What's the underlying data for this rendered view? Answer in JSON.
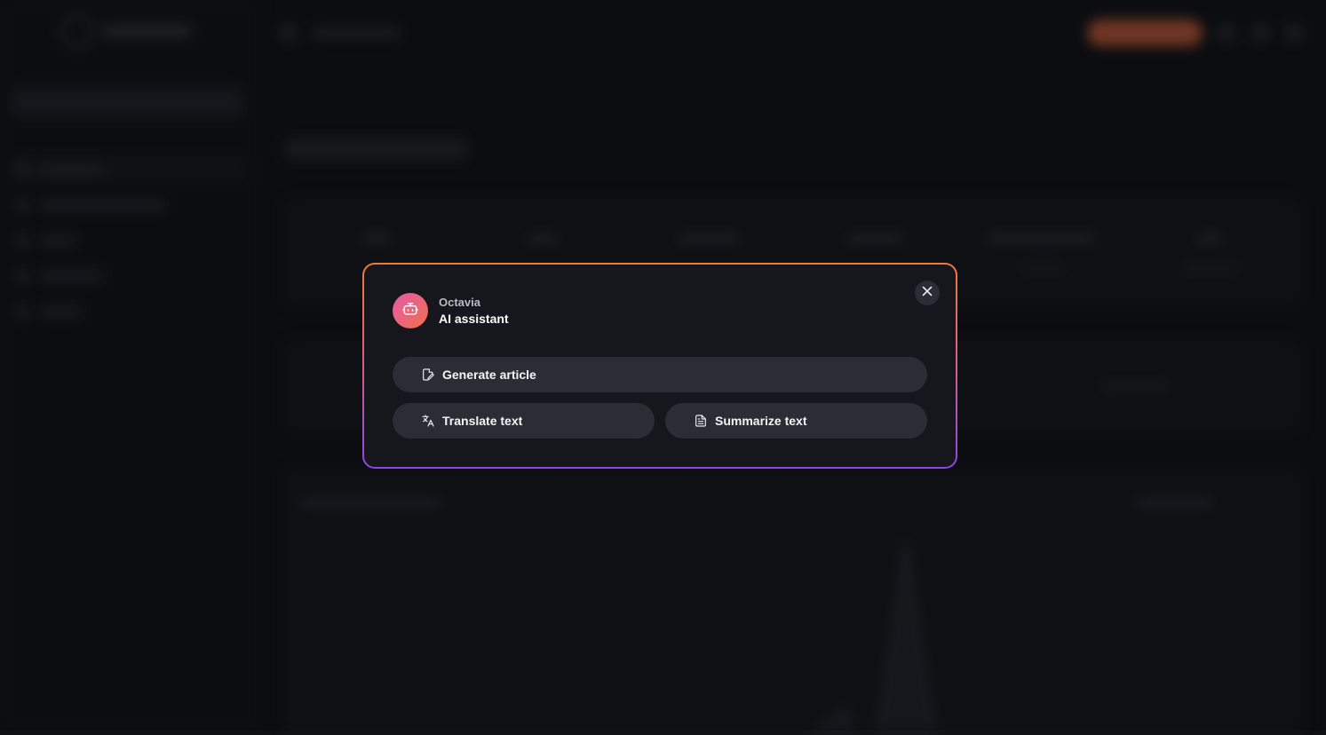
{
  "modal": {
    "assistant_name": "Octavia",
    "assistant_role": "AI assistant",
    "actions": [
      {
        "label": "Generate article",
        "icon": "edit-document-icon"
      },
      {
        "label": "Translate text",
        "icon": "translate-icon"
      },
      {
        "label": "Summarize text",
        "icon": "document-icon"
      }
    ],
    "close_icon": "close-icon",
    "avatar_icon": "robot-icon"
  },
  "colors": {
    "border_gradient_top": "#f07a3a",
    "border_gradient_bottom": "#8a45e8",
    "avatar_gradient_start": "#e75aa8",
    "avatar_gradient_end": "#f0704a",
    "modal_bg": "#15171c",
    "button_bg": "#2a2d34",
    "cta_bg": "#c25a35"
  }
}
